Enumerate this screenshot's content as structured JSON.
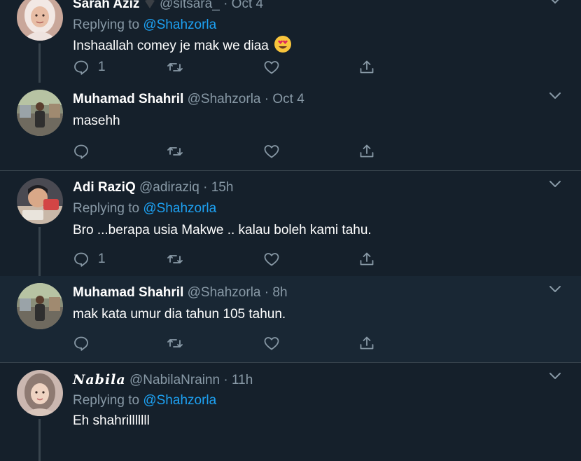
{
  "colors": {
    "background": "#15202b",
    "hover_background": "#192734",
    "divider": "#38444d",
    "secondary_text": "#8899a6",
    "accent": "#1da1f2"
  },
  "icons": {
    "reply": "reply-bubble-icon",
    "retweet": "retweet-arrows-icon",
    "like": "heart-outline-icon",
    "share": "share-upload-icon",
    "more": "chevron-down-icon"
  },
  "tweets": [
    {
      "name": "Sarah Aziz",
      "handle": "@sitsara_",
      "dot": "·",
      "time": "Oct 4",
      "replying_prefix": "Replying to ",
      "replying_to": "@Shahzorla",
      "text": "Inshaallah comey je mak we diaa",
      "emoji": "😍",
      "reply_count": "1"
    },
    {
      "name": "Muhamad Shahril",
      "handle": "@Shahzorla",
      "dot": "·",
      "time": "Oct 4",
      "text": "masehh",
      "reply_count": ""
    },
    {
      "name": "Adi RaziQ",
      "handle": "@adiraziq",
      "dot": "·",
      "time": "15h",
      "replying_prefix": "Replying to ",
      "replying_to": "@Shahzorla",
      "text": "Bro ...berapa usia Makwe .. kalau boleh kami tahu.",
      "reply_count": "1"
    },
    {
      "name": "Muhamad Shahril",
      "handle": "@Shahzorla",
      "dot": "·",
      "time": "8h",
      "text": "mak kata umur dia tahun 105 tahun.",
      "reply_count": ""
    },
    {
      "name": "Nabila",
      "handle": "@NabilaNrainn",
      "dot": "·",
      "time": "11h",
      "replying_prefix": "Replying to ",
      "replying_to": "@Shahzorla",
      "text": "Eh shahrilllllll"
    }
  ]
}
